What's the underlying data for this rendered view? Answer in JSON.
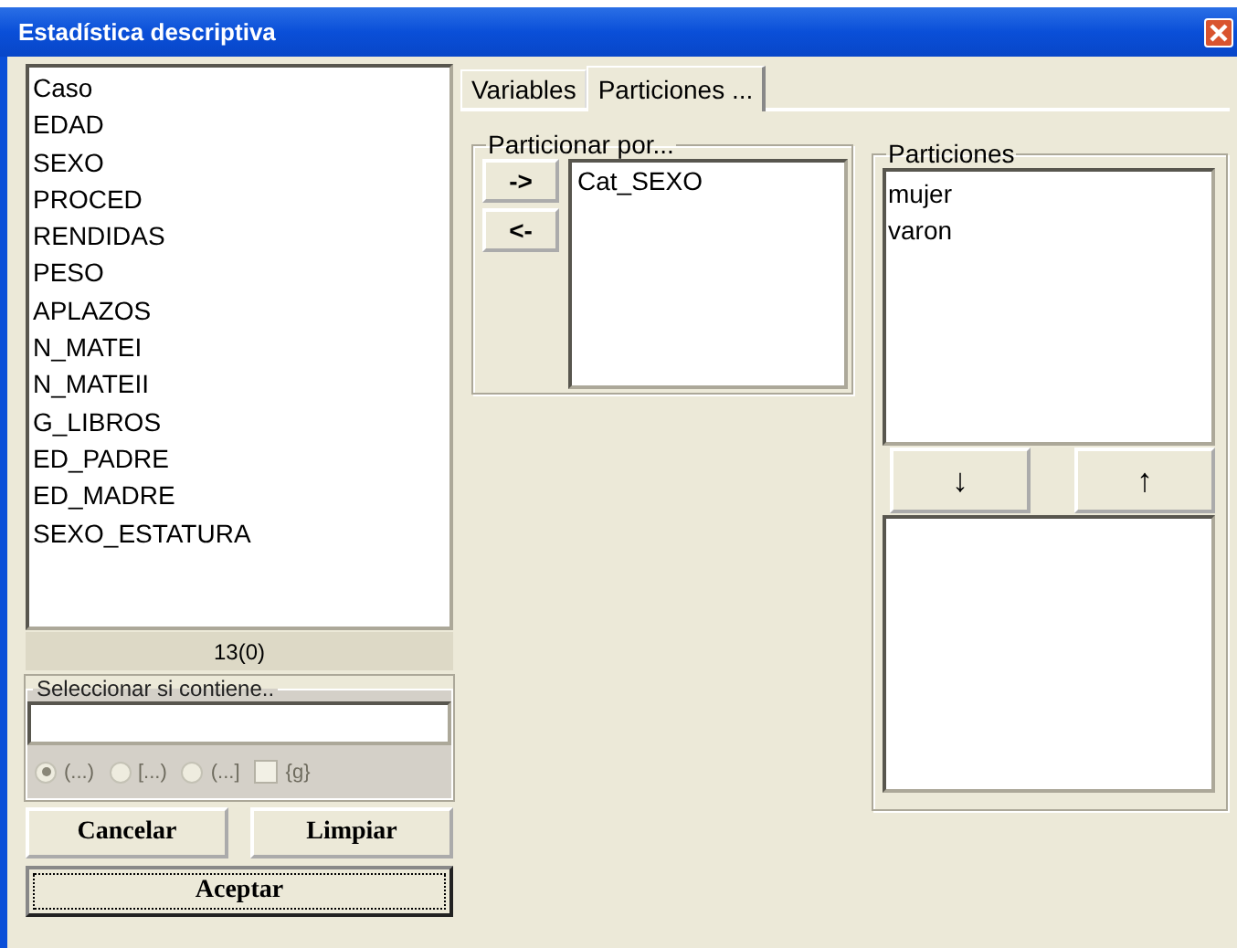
{
  "window": {
    "title": "Estadística descriptiva"
  },
  "variables": {
    "items": [
      "Caso",
      "EDAD",
      "SEXO",
      "PROCED",
      "RENDIDAS",
      "PESO",
      "APLAZOS",
      "N_MATEI",
      "N_MATEII",
      "G_LIBROS",
      "ED_PADRE",
      "ED_MADRE",
      "SEXO_ESTATURA"
    ],
    "count": "13(0)"
  },
  "filter": {
    "label": "Seleccionar si contiene..",
    "disabled": true,
    "options": [
      {
        "label": "(...)",
        "selected": true
      },
      {
        "label": "[...)",
        "selected": false
      },
      {
        "label": "(...]",
        "selected": false
      }
    ],
    "checkbox": {
      "label": "{g}",
      "checked": false
    }
  },
  "buttons": [
    {
      "label": "Cancelar",
      "focused": false
    },
    {
      "label": "Limpiar",
      "focused": false
    },
    {
      "label": "Aceptar",
      "focused": true
    }
  ],
  "tabs": [
    {
      "label": "Variables",
      "selected": false
    },
    {
      "label": "Particiones ...",
      "selected": true
    }
  ],
  "partition_by": {
    "label": "Particionar por...",
    "add": "->",
    "remove": "<-",
    "items": [
      "Cat_SEXO"
    ]
  },
  "partitions": {
    "label": "Particiones",
    "items": [
      "mujer",
      "varon"
    ],
    "down": "↓",
    "up": "↑"
  }
}
